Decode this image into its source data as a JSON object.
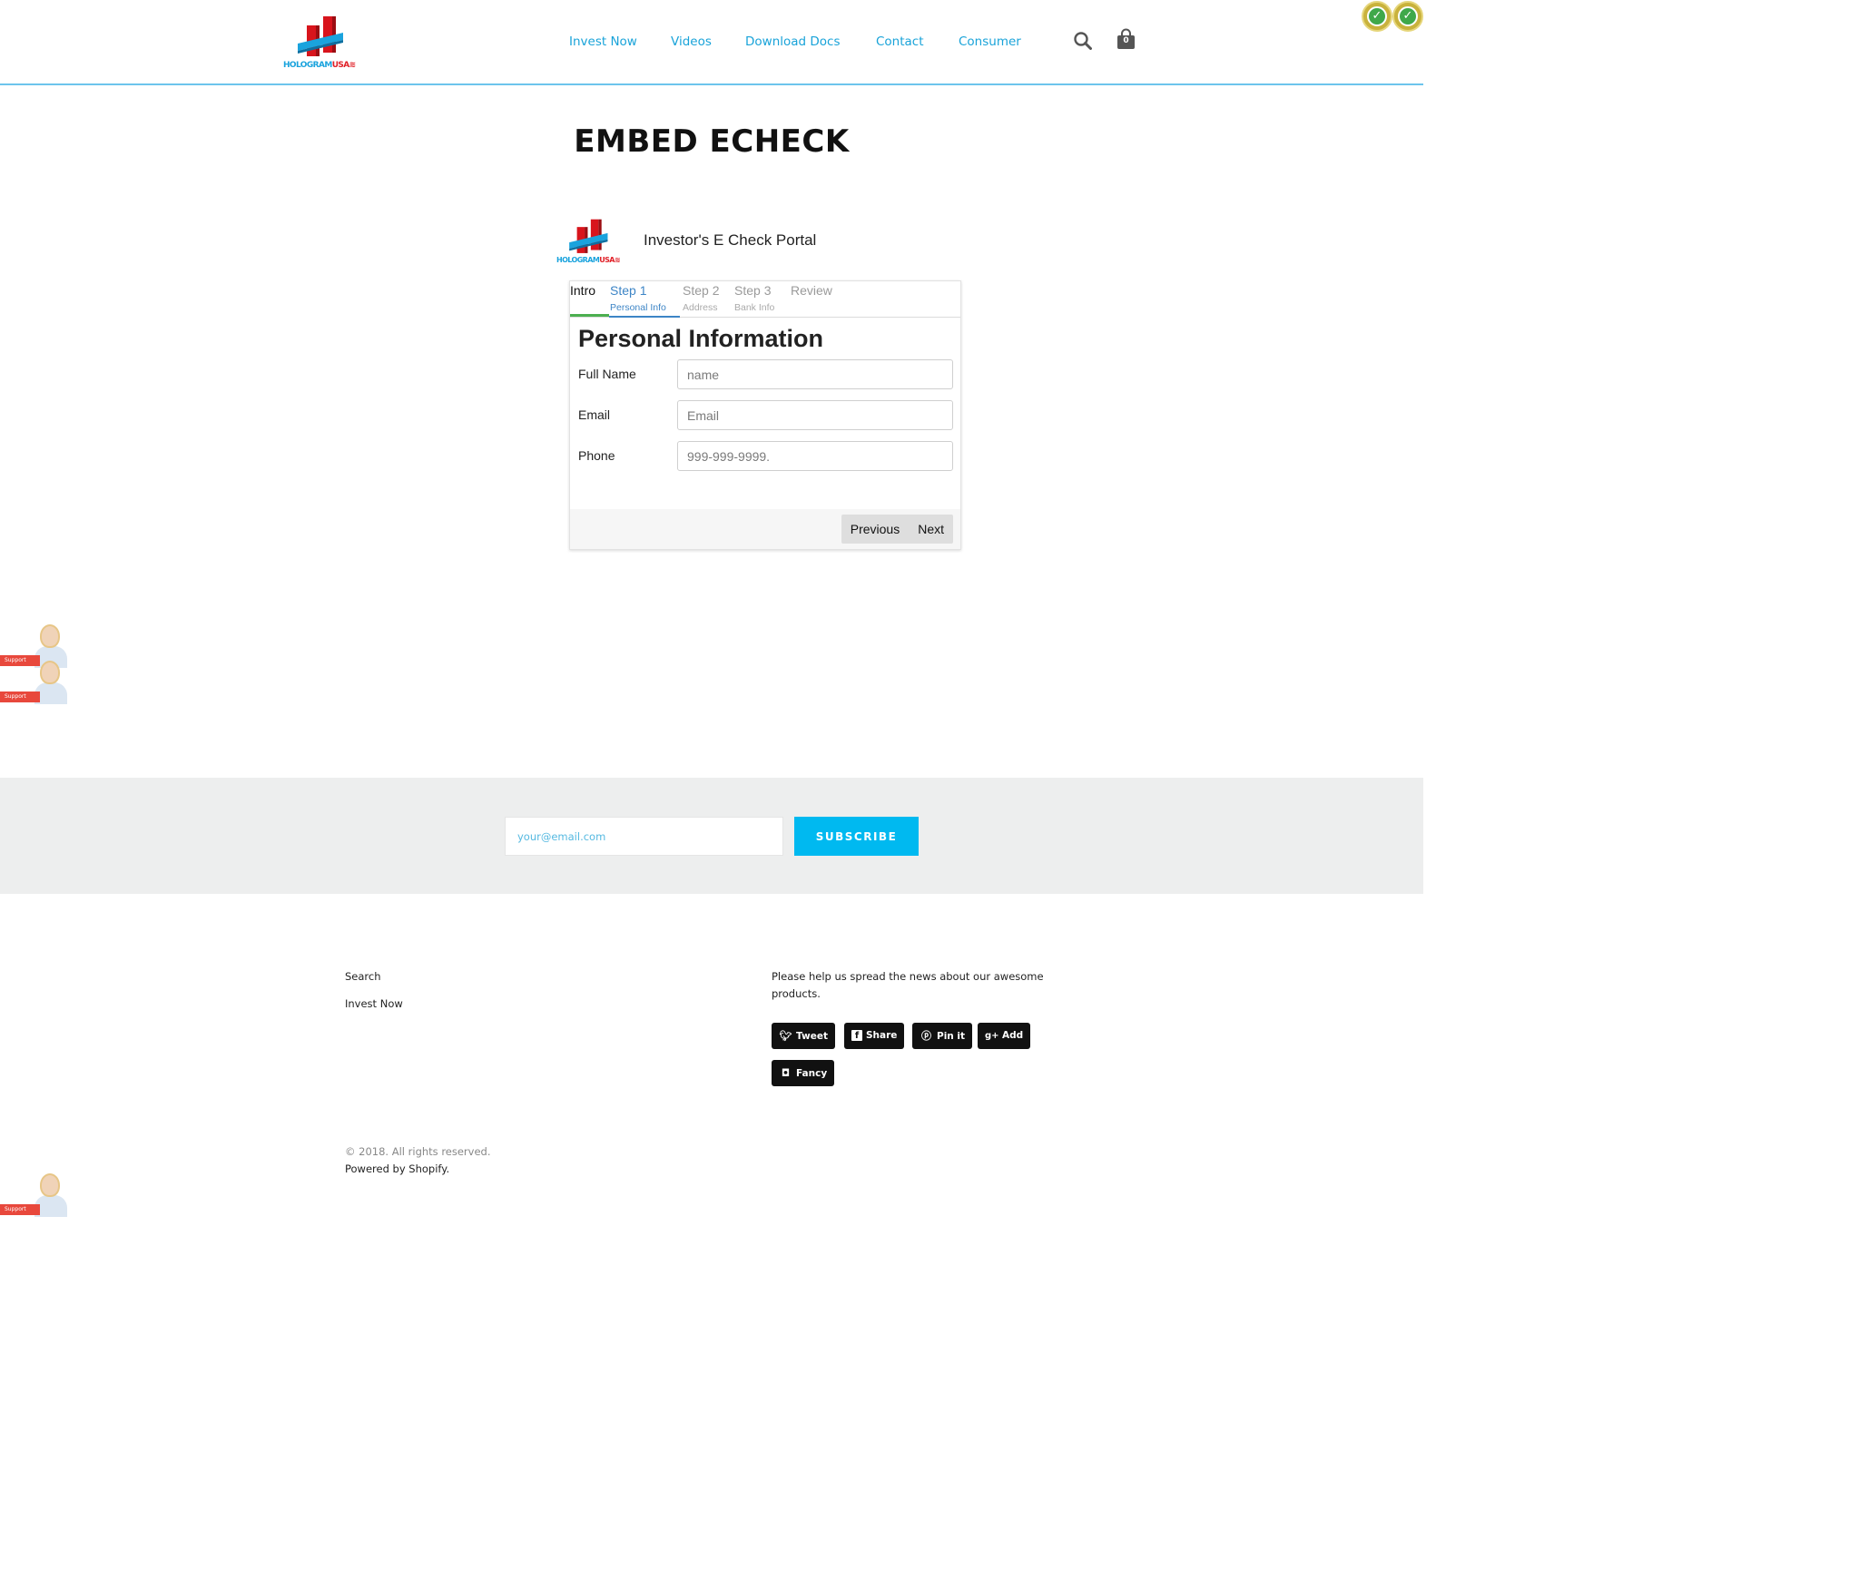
{
  "header": {
    "logo": {
      "text_main": "HOLOGRAM",
      "text_accent": "USA"
    },
    "nav": [
      {
        "label": "Invest Now"
      },
      {
        "label": "Videos"
      },
      {
        "label": "Download Docs"
      },
      {
        "label": "Contact"
      },
      {
        "label": "Consumer"
      }
    ],
    "search_icon": "search-icon",
    "cart_icon": "shopping-bag-icon",
    "cart_count": "0",
    "badges": [
      "verified-badge-icon",
      "verified-badge-icon"
    ]
  },
  "page": {
    "title": "EMBED ECHECK"
  },
  "portal": {
    "title": "Investor's E Check Portal",
    "steps": [
      {
        "label": "Intro",
        "sub": "",
        "state": "done"
      },
      {
        "label": "Step 1",
        "sub": "Personal Info",
        "state": "active"
      },
      {
        "label": "Step 2",
        "sub": "Address",
        "state": "pending"
      },
      {
        "label": "Step 3",
        "sub": "Bank Info",
        "state": "pending"
      },
      {
        "label": "Review",
        "sub": "",
        "state": "pending"
      }
    ],
    "form_title": "Personal Information",
    "fields": [
      {
        "label": "Full Name",
        "placeholder": "name",
        "value": ""
      },
      {
        "label": "Email",
        "placeholder": "Email",
        "value": ""
      },
      {
        "label": "Phone",
        "placeholder": "999-999-9999.",
        "value": ""
      }
    ],
    "previous_label": "Previous",
    "next_label": "Next",
    "colors": {
      "active": "#3d85c6",
      "done": "#4caf50"
    }
  },
  "support": {
    "label": "Support"
  },
  "newsletter": {
    "placeholder": "your@email.com",
    "button_label": "SUBSCRIBE"
  },
  "footer": {
    "links": [
      "Search",
      "Invest Now"
    ],
    "share_text": "Please help us spread the news about our awesome products.",
    "share_buttons": [
      {
        "label": "Tweet",
        "icon": "twitter-icon"
      },
      {
        "label": "Share",
        "icon": "facebook-icon"
      },
      {
        "label": "Pin it",
        "icon": "pinterest-icon"
      },
      {
        "label": "Add",
        "icon": "google-plus-icon"
      },
      {
        "label": "Fancy",
        "icon": "fancy-icon"
      }
    ],
    "copyright": "© 2018. All rights reserved.",
    "powered_by": "Powered by Shopify."
  },
  "colors": {
    "accent": "#19a3d9",
    "subscribe": "#00b9f0",
    "logo_red": "#e01f26",
    "logo_blue": "#1aa3dd"
  }
}
